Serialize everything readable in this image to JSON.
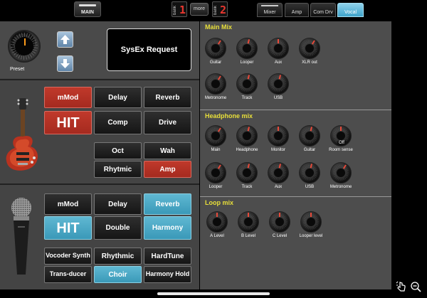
{
  "topbar": {
    "main_label": "MAIN",
    "bank1": {
      "word": "bank",
      "number": "1"
    },
    "more_label": "more",
    "bank2": {
      "word": "bank",
      "number": "2"
    },
    "tabs": [
      {
        "label": "Mixer",
        "state": "selected"
      },
      {
        "label": "Amp",
        "state": "normal"
      },
      {
        "label": "Com Drv",
        "state": "normal"
      },
      {
        "label": "Vocal",
        "state": "active"
      }
    ]
  },
  "preset": {
    "label": "Preset"
  },
  "sysex_label": "SysEx Request",
  "guitar_fx": {
    "row1": [
      "mMod",
      "Delay",
      "Reverb"
    ],
    "hit": "HIT",
    "row2": [
      "Comp",
      "Drive"
    ],
    "row3": [
      "Oct",
      "Wah"
    ],
    "row4": [
      "Rhytmic",
      "Amp"
    ],
    "active": [
      "mMod",
      "HIT",
      "Amp"
    ]
  },
  "vocal_fx": {
    "row1": [
      "mMod",
      "Delay",
      "Reverb"
    ],
    "hit": "HIT",
    "row2": [
      "Double",
      "Harmony"
    ],
    "row3": [
      "Vocoder Synth",
      "Rhythmic",
      "HardTune"
    ],
    "row4": [
      "Trans-ducer",
      "Choir",
      "Harmony Hold"
    ],
    "active": [
      "Reverb",
      "HIT",
      "Harmony",
      "Choir"
    ]
  },
  "mixer": {
    "main_mix": {
      "title": "Main Mix",
      "knobs": [
        {
          "label": "Guitar",
          "value": 0.62
        },
        {
          "label": "Looper",
          "value": 0.55
        },
        {
          "label": "Aux",
          "value": 0.5
        },
        {
          "label": "XLR out",
          "value": 0.62
        },
        {
          "label": "Metronome",
          "value": 0.62
        },
        {
          "label": "Track",
          "value": 0.55
        },
        {
          "label": "USB",
          "value": 0.55
        }
      ]
    },
    "headphone_mix": {
      "title": "Headphone mix",
      "knobs": [
        {
          "label": "Main",
          "value": 0.62
        },
        {
          "label": "Headphone",
          "value": 0.55
        },
        {
          "label": "Monitor",
          "value": 0.5
        },
        {
          "label": "Guitar",
          "value": 0.55
        },
        {
          "label": "Room sense",
          "value": 0.5,
          "badge": "Off"
        },
        {
          "label": "Looper",
          "value": 0.62
        },
        {
          "label": "Track",
          "value": 0.55
        },
        {
          "label": "Aux",
          "value": 0.55
        },
        {
          "label": "USB",
          "value": 0.55
        },
        {
          "label": "Metronome",
          "value": 0.62
        }
      ]
    },
    "loop_mix": {
      "title": "Loop mix",
      "knobs": [
        {
          "label": "A Level",
          "value": 0.5
        },
        {
          "label": "B Level",
          "value": 0.5
        },
        {
          "label": "C Level",
          "value": 0.5
        },
        {
          "label": "Looper level",
          "value": 0.5
        }
      ]
    }
  },
  "colors": {
    "accent_red": "#c0392b",
    "accent_blue": "#4aa8c8",
    "title_yellow": "#e8df3a"
  }
}
